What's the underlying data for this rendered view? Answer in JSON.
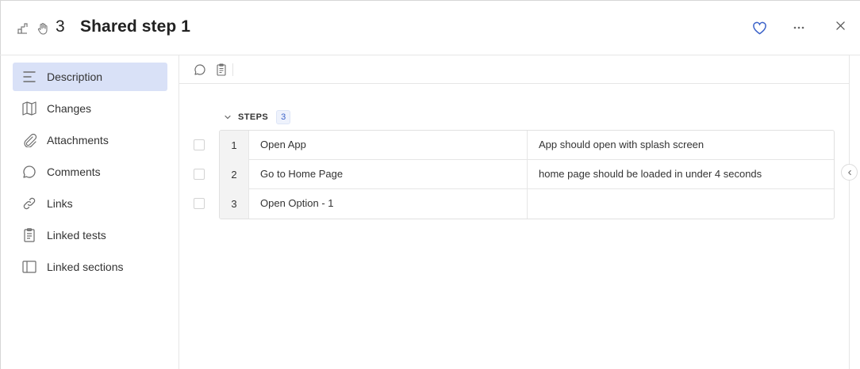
{
  "header": {
    "id": "3",
    "title": "Shared step 1",
    "icons": [
      "shared-step-icon",
      "hand-icon"
    ],
    "actions": [
      "heart-icon",
      "more-icon",
      "close-icon"
    ]
  },
  "sidebar": {
    "items": [
      {
        "label": "Description",
        "icon": "description-icon",
        "active": true
      },
      {
        "label": "Changes",
        "icon": "map-icon",
        "active": false
      },
      {
        "label": "Attachments",
        "icon": "paperclip-icon",
        "active": false
      },
      {
        "label": "Comments",
        "icon": "comment-icon",
        "active": false
      },
      {
        "label": "Links",
        "icon": "link-icon",
        "active": false
      },
      {
        "label": "Linked tests",
        "icon": "clipboard-icon",
        "active": false
      },
      {
        "label": "Linked sections",
        "icon": "panel-icon",
        "active": false
      }
    ]
  },
  "toolbar": {
    "icons": [
      "comment-icon",
      "clipboard-icon"
    ]
  },
  "steps": {
    "label": "STEPS",
    "count": "3",
    "rows": [
      {
        "num": "1",
        "action": "Open App",
        "expected": "App should open with splash screen"
      },
      {
        "num": "2",
        "action": "Go to Home Page",
        "expected": "home page should be loaded in under 4 seconds"
      },
      {
        "num": "3",
        "action": "Open Option - 1",
        "expected": ""
      }
    ]
  },
  "colors": {
    "accent": "#3b62c9",
    "active_bg": "#d9e1f7"
  }
}
